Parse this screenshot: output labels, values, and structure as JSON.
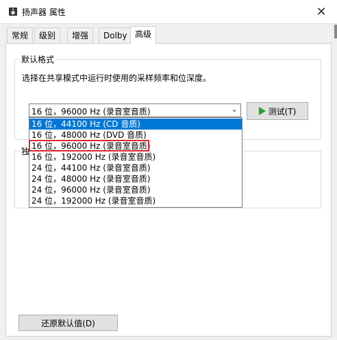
{
  "window": {
    "title": "扬声器 属性"
  },
  "tabs": [
    {
      "label": "常规"
    },
    {
      "label": "级别"
    },
    {
      "label": "增强"
    },
    {
      "label": "Dolby"
    },
    {
      "label": "高级"
    }
  ],
  "default_format": {
    "group_label": "默认格式",
    "description": "选择在共享模式中运行时使用的采样频率和位深度。",
    "selected_value": "16 位，96000 Hz (录音室音质)",
    "test_button_label": "▶ 测试(T)",
    "options": [
      "16 位，44100 Hz (CD 音质)",
      "16 位，48000 Hz (DVD 音质)",
      "16 位，96000 Hz (录音室音质)",
      "16 位，192000 Hz (录音室音质)",
      "24 位，44100 Hz (录音室音质)",
      "24 位，48000 Hz (录音室音质)",
      "24 位，96000 Hz (录音室音质)",
      "24 位，192000 Hz (录音室音质)"
    ],
    "highlighted_index": 0,
    "annotated_index": 2
  },
  "exclusive": {
    "group_label_partial": "独"
  },
  "restore_defaults_label": "还原默认值(D)",
  "colors": {
    "highlight": "#0078d7",
    "annotation": "#d9282e",
    "play": "#2a9d2a"
  }
}
